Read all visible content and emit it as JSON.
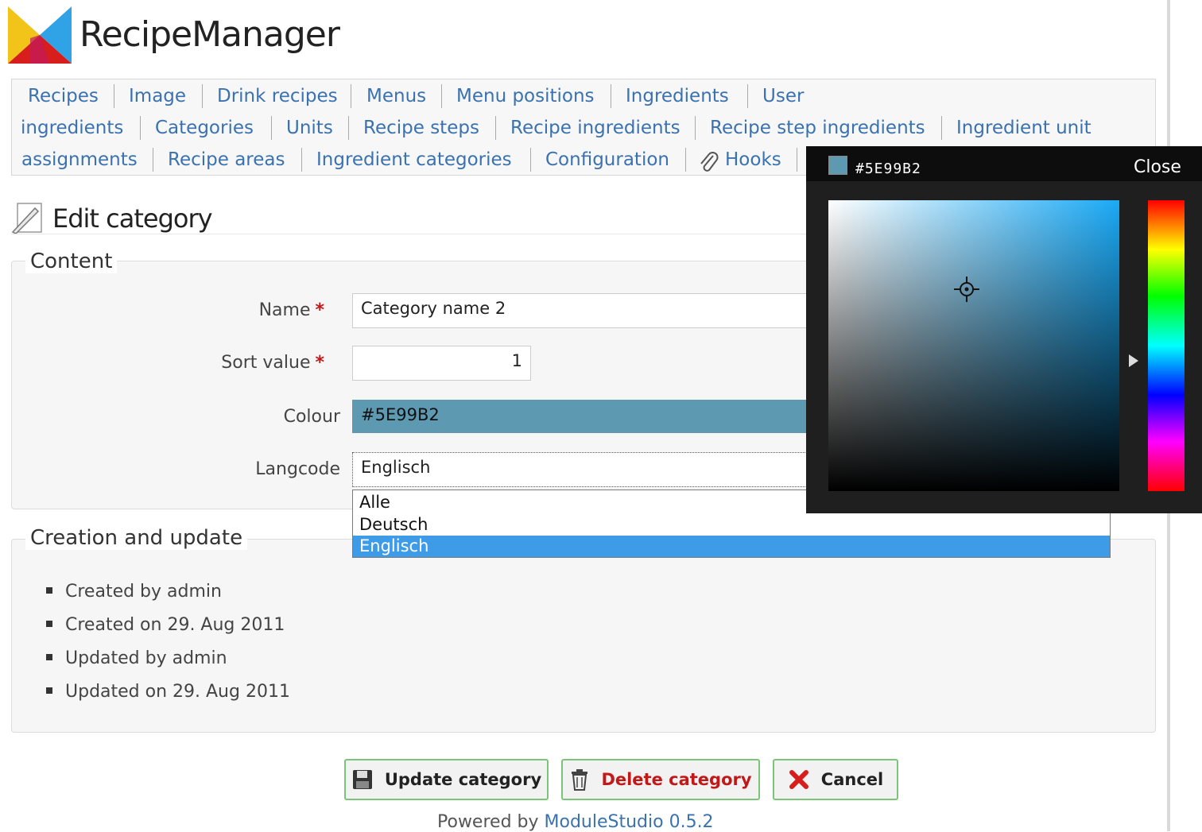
{
  "app": {
    "title": "RecipeManager"
  },
  "nav": {
    "items": [
      "Recipes",
      "Image",
      "Drink recipes",
      "Menus",
      "Menu positions",
      "Ingredients",
      "User",
      "ingredients",
      "Categories",
      "Units",
      "Recipe steps",
      "Recipe ingredients",
      "Recipe step ingredients",
      "Ingredient unit",
      "assignments",
      "Recipe areas",
      "Ingredient categories",
      "Configuration",
      "Hooks"
    ]
  },
  "page": {
    "title": "Edit category"
  },
  "content": {
    "legend": "Content",
    "name_label": "Name",
    "name_value": "Category name 2",
    "sort_label": "Sort value",
    "sort_value": "1",
    "colour_label": "Colour",
    "colour_value": "#5E99B2",
    "lang_label": "Langcode",
    "lang_value": "Englisch",
    "lang_options": [
      "Alle",
      "Deutsch",
      "Englisch"
    ],
    "required_mark": "*"
  },
  "meta": {
    "legend": "Creation and update",
    "items": [
      "Created by admin",
      "Created on 29. Aug 2011",
      "Updated by admin",
      "Updated on 29. Aug 2011"
    ]
  },
  "buttons": {
    "update": "Update category",
    "delete": "Delete category",
    "cancel": "Cancel"
  },
  "footer": {
    "prefix": "Powered by",
    "link": "ModuleStudio 0.5.2"
  },
  "picker": {
    "hex": "#5E99B2",
    "close": "Close",
    "swatch_color": "#5E99B2"
  },
  "colors": {
    "link": "#3a72b0",
    "delete": "#c31818",
    "selected": "#3d9be8",
    "picked": "#5E99B2"
  }
}
